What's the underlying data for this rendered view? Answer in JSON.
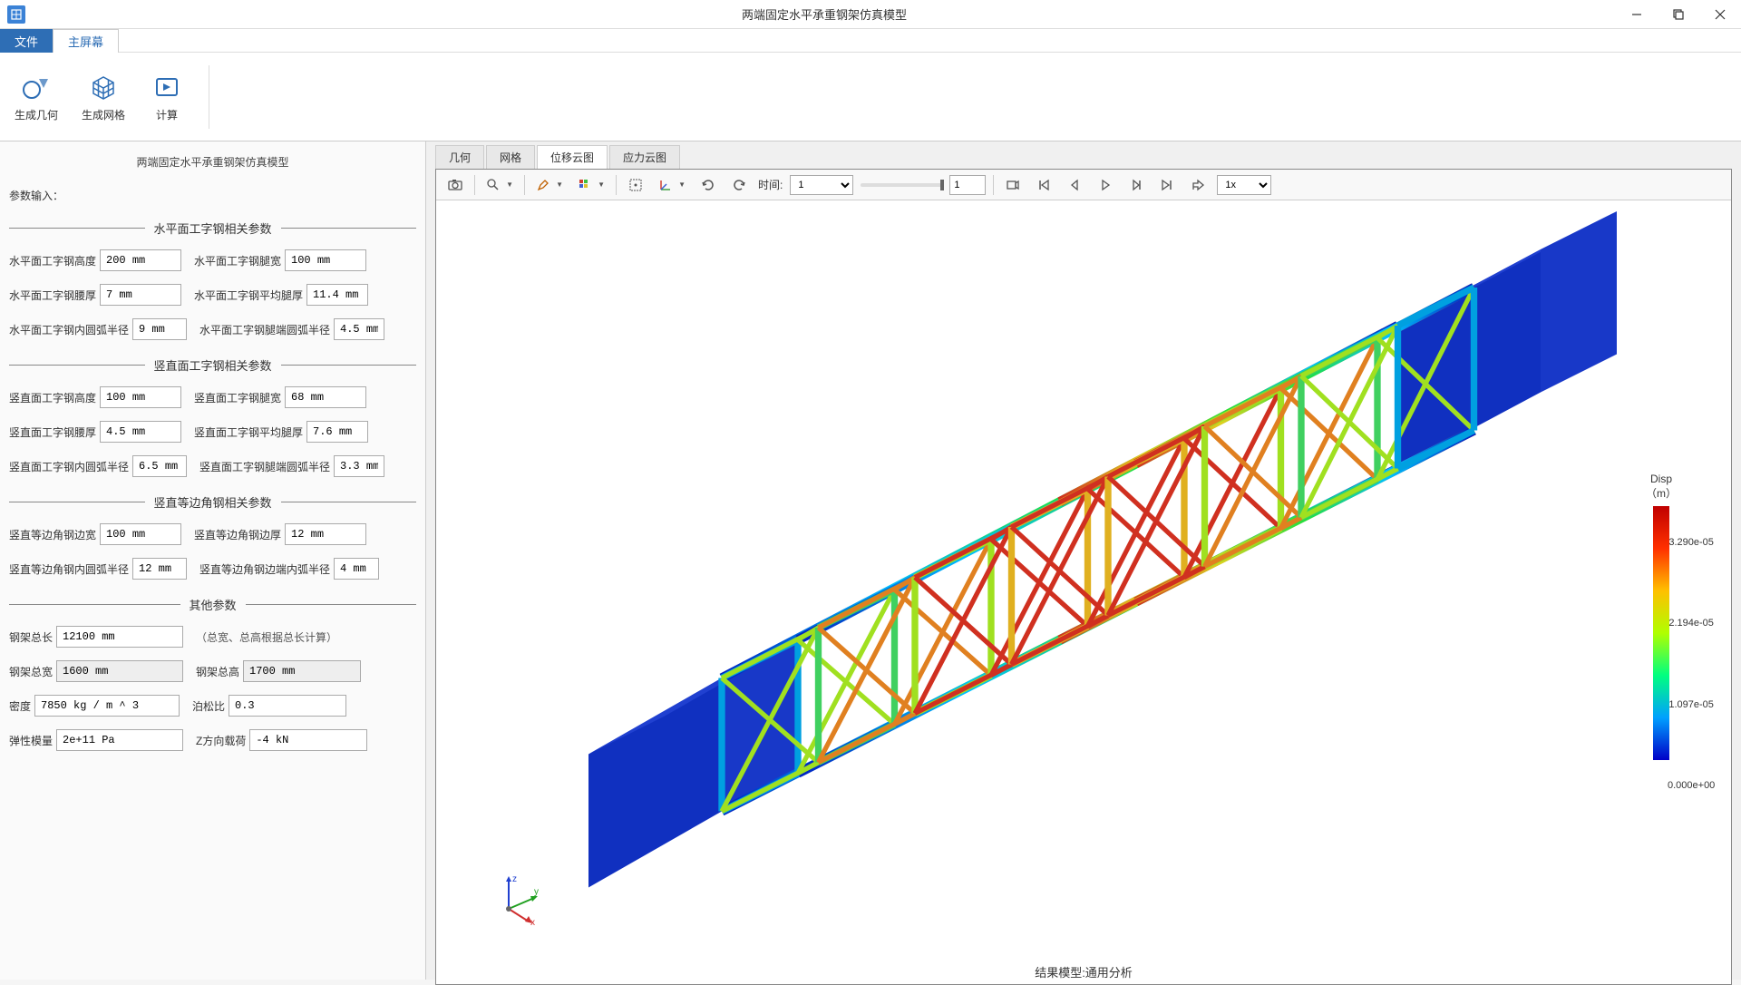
{
  "window": {
    "title": "两端固定水平承重钢架仿真模型"
  },
  "menu": {
    "file": "文件",
    "main": "主屏幕"
  },
  "ribbon": {
    "geom": "生成几何",
    "mesh": "生成网格",
    "calc": "计算"
  },
  "sidebar": {
    "title": "两端固定水平承重钢架仿真模型",
    "input_label": "参数输入：",
    "sec1": "水平面工字钢相关参数",
    "h_height_l": "水平面工字钢高度",
    "h_height_v": "200 mm",
    "h_legw_l": "水平面工字钢腿宽",
    "h_legw_v": "100 mm",
    "h_webt_l": "水平面工字钢腰厚",
    "h_webt_v": "7 mm",
    "h_avglegt_l": "水平面工字钢平均腿厚",
    "h_avglegt_v": "11.4 mm",
    "h_innerR_l": "水平面工字钢内圆弧半径",
    "h_innerR_v": "9 mm",
    "h_legendR_l": "水平面工字钢腿端圆弧半径",
    "h_legendR_v": "4.5 mm",
    "sec2": "竖直面工字钢相关参数",
    "v_height_l": "竖直面工字钢高度",
    "v_height_v": "100 mm",
    "v_legw_l": "竖直面工字钢腿宽",
    "v_legw_v": "68 mm",
    "v_webt_l": "竖直面工字钢腰厚",
    "v_webt_v": "4.5 mm",
    "v_avglegt_l": "竖直面工字钢平均腿厚",
    "v_avglegt_v": "7.6 mm",
    "v_innerR_l": "竖直面工字钢内圆弧半径",
    "v_innerR_v": "6.5 mm",
    "v_legendR_l": "竖直面工字钢腿端圆弧半径",
    "v_legendR_v": "3.3 mm",
    "sec3": "竖直等边角钢相关参数",
    "a_sidew_l": "竖直等边角钢边宽",
    "a_sidew_v": "100 mm",
    "a_sidet_l": "竖直等边角钢边厚",
    "a_sidet_v": "12 mm",
    "a_innerR_l": "竖直等边角钢内圆弧半径",
    "a_innerR_v": "12 mm",
    "a_endR_l": "竖直等边角钢边端内弧半径",
    "a_endR_v": "4 mm",
    "sec4": "其他参数",
    "totlen_l": "钢架总长",
    "totlen_v": "12100 mm",
    "totlen_note": "（总宽、总高根据总长计算）",
    "totw_l": "钢架总宽",
    "totw_v": "1600 mm",
    "toth_l": "钢架总高",
    "toth_v": "1700 mm",
    "density_l": "密度",
    "density_v": "7850 kg / m ^ 3",
    "poisson_l": "泊松比",
    "poisson_v": "0.3",
    "modulus_l": "弹性模量",
    "modulus_v": "2e+11 Pa",
    "zload_l": "Z方向载荷",
    "zload_v": "-4 kN"
  },
  "main_tabs": {
    "geom": "几何",
    "mesh": "网格",
    "disp": "位移云图",
    "stress": "应力云图"
  },
  "toolbar": {
    "time_l": "时间:",
    "time_sel": "1",
    "frame": "1",
    "speed": "1x"
  },
  "result": {
    "caption": "结果模型:通用分析",
    "legend_title": "Disp",
    "legend_unit": "（m）",
    "tick_max": "3.290e-05",
    "tick_2": "2.194e-05",
    "tick_1": "1.097e-05",
    "tick_min": "0.000e+00"
  }
}
